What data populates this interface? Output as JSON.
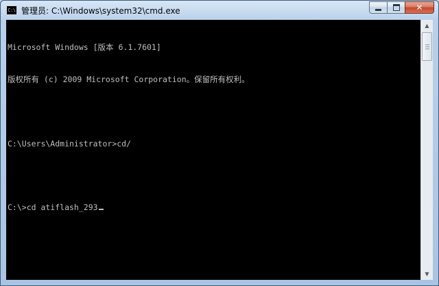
{
  "window": {
    "title": "管理员: C:\\Windows\\system32\\cmd.exe",
    "icon_text": "C:\\",
    "icon": "console-icon",
    "buttons": {
      "minimize_icon": "minimize-icon",
      "maximize_icon": "maximize-icon",
      "close_label": "✕"
    }
  },
  "console": {
    "lines": [
      "Microsoft Windows [版本 6.1.7601]",
      "版权所有 (c) 2009 Microsoft Corporation。保留所有权利。",
      "",
      "C:\\Users\\Administrator>cd/",
      "",
      "C:\\>cd atiflash_293"
    ],
    "colors": {
      "background": "#000000",
      "text": "#c0c0c0"
    }
  },
  "scrollbar": {
    "up_arrow": "▲",
    "down_arrow": "▼"
  }
}
